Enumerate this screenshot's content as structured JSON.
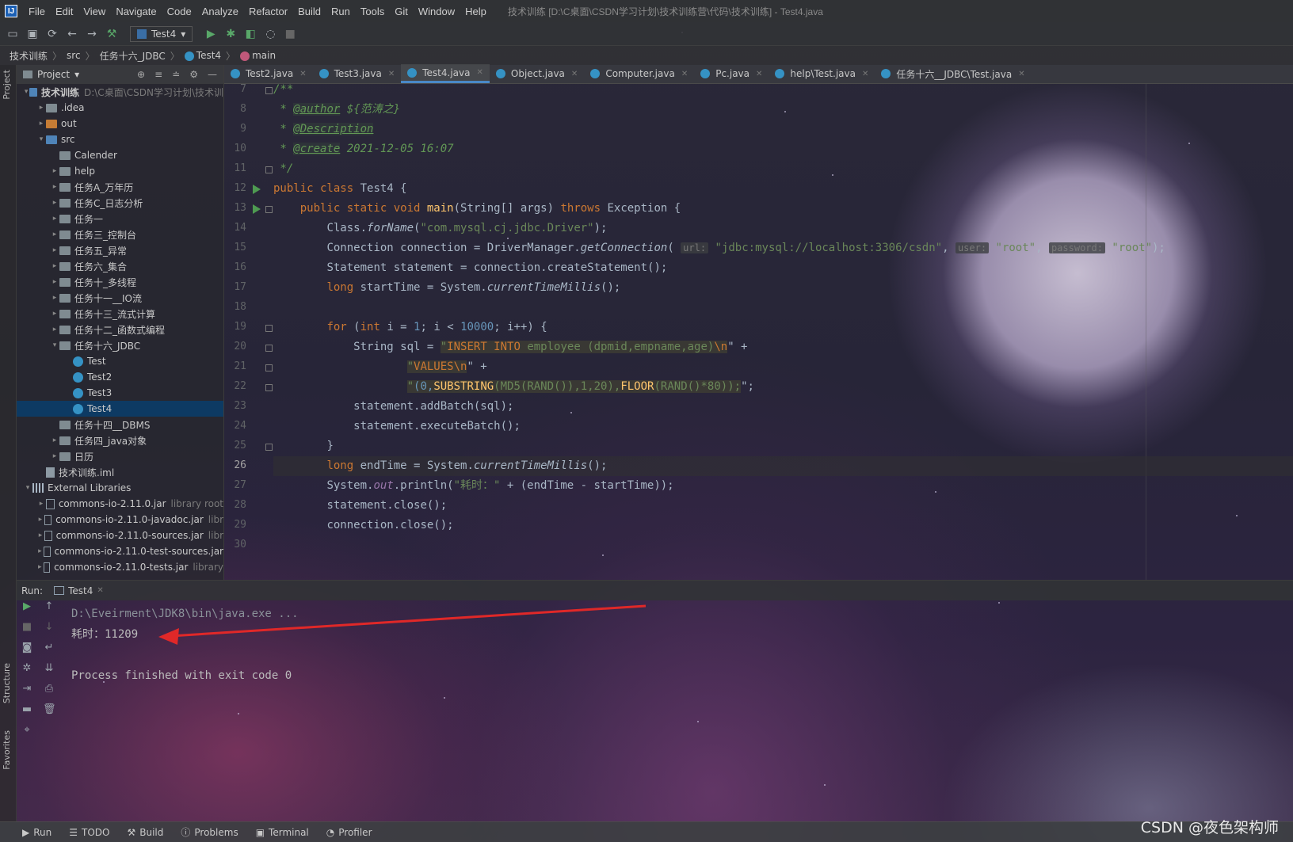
{
  "menu": {
    "logo": "IJ",
    "items": [
      "File",
      "Edit",
      "View",
      "Navigate",
      "Code",
      "Analyze",
      "Refactor",
      "Build",
      "Run",
      "Tools",
      "Git",
      "Window",
      "Help"
    ],
    "window_title": "技术训练 [D:\\C桌面\\CSDN学习计划\\技术训练营\\代码\\技术训练] - Test4.java"
  },
  "toolbar": {
    "run_config": "Test4"
  },
  "breadcrumb": [
    "技术训练",
    "src",
    "任务十六_JDBC",
    "Test4",
    "main"
  ],
  "sidebar_tabs": {
    "project": "Project",
    "structure": "Structure",
    "favorites": "Favorites"
  },
  "project_panel": {
    "title": "Project",
    "tree": [
      {
        "label": "技术训练",
        "hint": "D:\\C桌面\\CSDN学习计划\\技术训",
        "depth": 0,
        "arrow": "▾",
        "icon": "folder-blue",
        "bold": true
      },
      {
        "label": ".idea",
        "hint": "",
        "depth": 1,
        "arrow": "▸",
        "icon": "folder"
      },
      {
        "label": "out",
        "hint": "",
        "depth": 1,
        "arrow": "▸",
        "icon": "folder-orange"
      },
      {
        "label": "src",
        "hint": "",
        "depth": 1,
        "arrow": "▾",
        "icon": "folder-blue"
      },
      {
        "label": "Calender",
        "hint": "",
        "depth": 2,
        "arrow": "",
        "icon": "folder"
      },
      {
        "label": "help",
        "hint": "",
        "depth": 2,
        "arrow": "▸",
        "icon": "folder"
      },
      {
        "label": "任务A_万年历",
        "hint": "",
        "depth": 2,
        "arrow": "▸",
        "icon": "folder"
      },
      {
        "label": "任务C_日志分析",
        "hint": "",
        "depth": 2,
        "arrow": "▸",
        "icon": "folder"
      },
      {
        "label": "任务一",
        "hint": "",
        "depth": 2,
        "arrow": "▸",
        "icon": "folder"
      },
      {
        "label": "任务三_控制台",
        "hint": "",
        "depth": 2,
        "arrow": "▸",
        "icon": "folder"
      },
      {
        "label": "任务五_异常",
        "hint": "",
        "depth": 2,
        "arrow": "▸",
        "icon": "folder"
      },
      {
        "label": "任务六_集合",
        "hint": "",
        "depth": 2,
        "arrow": "▸",
        "icon": "folder"
      },
      {
        "label": "任务十_多线程",
        "hint": "",
        "depth": 2,
        "arrow": "▸",
        "icon": "folder"
      },
      {
        "label": "任务十一__IO流",
        "hint": "",
        "depth": 2,
        "arrow": "▸",
        "icon": "folder"
      },
      {
        "label": "任务十三_流式计算",
        "hint": "",
        "depth": 2,
        "arrow": "▸",
        "icon": "folder"
      },
      {
        "label": "任务十二_函数式编程",
        "hint": "",
        "depth": 2,
        "arrow": "▸",
        "icon": "folder"
      },
      {
        "label": "任务十六_JDBC",
        "hint": "",
        "depth": 2,
        "arrow": "▾",
        "icon": "folder"
      },
      {
        "label": "Test",
        "hint": "",
        "depth": 3,
        "arrow": "",
        "icon": "class"
      },
      {
        "label": "Test2",
        "hint": "",
        "depth": 3,
        "arrow": "",
        "icon": "class"
      },
      {
        "label": "Test3",
        "hint": "",
        "depth": 3,
        "arrow": "",
        "icon": "class"
      },
      {
        "label": "Test4",
        "hint": "",
        "depth": 3,
        "arrow": "",
        "icon": "class",
        "selected": true
      },
      {
        "label": "任务十四__DBMS",
        "hint": "",
        "depth": 2,
        "arrow": "",
        "icon": "folder"
      },
      {
        "label": "任务四_java对象",
        "hint": "",
        "depth": 2,
        "arrow": "▸",
        "icon": "folder"
      },
      {
        "label": "日历",
        "hint": "",
        "depth": 2,
        "arrow": "▸",
        "icon": "folder"
      },
      {
        "label": "技术训练.iml",
        "hint": "",
        "depth": 1,
        "arrow": "",
        "icon": "iml"
      },
      {
        "label": "External Libraries",
        "hint": "",
        "depth": 0,
        "arrow": "▾",
        "icon": "lib"
      },
      {
        "label": "commons-io-2.11.0.jar",
        "hint": "library root",
        "depth": 1,
        "arrow": "▸",
        "icon": "jar"
      },
      {
        "label": "commons-io-2.11.0-javadoc.jar",
        "hint": "libr",
        "depth": 1,
        "arrow": "▸",
        "icon": "jar"
      },
      {
        "label": "commons-io-2.11.0-sources.jar",
        "hint": "libr",
        "depth": 1,
        "arrow": "▸",
        "icon": "jar"
      },
      {
        "label": "commons-io-2.11.0-test-sources.jar",
        "hint": "",
        "depth": 1,
        "arrow": "▸",
        "icon": "jar"
      },
      {
        "label": "commons-io-2.11.0-tests.jar",
        "hint": "library",
        "depth": 1,
        "arrow": "▸",
        "icon": "jar"
      }
    ]
  },
  "editor_tabs": [
    {
      "label": "Test2.java",
      "active": false
    },
    {
      "label": "Test3.java",
      "active": false
    },
    {
      "label": "Test4.java",
      "active": true
    },
    {
      "label": "Object.java",
      "active": false
    },
    {
      "label": "Computer.java",
      "active": false
    },
    {
      "label": "Pc.java",
      "active": false
    },
    {
      "label": "help\\Test.java",
      "active": false
    },
    {
      "label": "任务十六__JDBC\\Test.java",
      "active": false
    }
  ],
  "line_numbers": [
    "7",
    "8",
    "9",
    "10",
    "11",
    "12",
    "13",
    "14",
    "15",
    "16",
    "17",
    "18",
    "19",
    "20",
    "21",
    "22",
    "23",
    "24",
    "25",
    "26",
    "27",
    "28",
    "29",
    "30"
  ],
  "current_line": "26",
  "code": {
    "l7": "/**",
    "l8_star": " * ",
    "l8_tag": "@author",
    "l8_val": " ${范涛之}",
    "l9_star": " * ",
    "l9_tag": "@Description",
    "l10_star": " * ",
    "l10_tag": "@create",
    "l10_val": " 2021-12-05 16:07",
    "l11": " */",
    "l12_kw": "public class",
    "l12_rest": " Test4 {",
    "l13_kw": "public static void",
    "l13_fn": "main",
    "l13_args": "(String[] args) ",
    "l13_throws": "throws",
    "l13_rest": " Exception {",
    "l14_a": "Class.",
    "l14_m": "forName",
    "l14_s": "\"com.mysql.cj.jdbc.Driver\"",
    "l14_e": ");",
    "l15_a": "Connection connection = DriverManager.",
    "l15_m": "getConnection",
    "l15_h1": "url:",
    "l15_s1": "\"jdbc:mysql://localhost:3306/csdn\"",
    "l15_h2": "user:",
    "l15_s2": "\"root\"",
    "l15_h3": "password:",
    "l15_s3": "\"root\"",
    "l15_e": ");",
    "l16": "Statement statement = connection.createStatement();",
    "l17_kw": "long",
    "l17_a": " startTime = System.",
    "l17_m": "currentTimeMillis",
    "l17_e": "();",
    "l19_kw": "for",
    "l19_a": " (",
    "l19_int": "int",
    "l19_b": " i = ",
    "l19_n1": "1",
    "l19_c": "; i < ",
    "l19_n2": "10000",
    "l19_d": "; i++) {",
    "l20_a": "String sql = ",
    "l20_q": "\"",
    "l20_k1": "INSERT INTO",
    "l20_b": " employee (dpmid,empname,age)",
    "l20_esc": "\\n",
    "l20_e": "\" +",
    "l21_q": "\"",
    "l21_k": "VALUES",
    "l21_esc": "\\n",
    "l21_e": "\" +",
    "l22_q": "\"",
    "l22_a": "(0,",
    "l22_f1": "SUBSTRING",
    "l22_b": "(MD5(RAND()),1,20),",
    "l22_f2": "FLOOR",
    "l22_c": "(RAND()*80));",
    "l22_e": "\";",
    "l23": "statement.addBatch(sql);",
    "l24": "statement.executeBatch();",
    "l25": "}",
    "l26_kw": "long",
    "l26_a": " endTime = System.",
    "l26_m": "currentTimeMillis",
    "l26_e": "();",
    "l27_a": "System.",
    "l27_out": "out",
    "l27_b": ".println(",
    "l27_s": "\"耗时：\"",
    "l27_c": " + (endTime - startTime));",
    "l28": "statement.close();",
    "l29": "connection.close();"
  },
  "run_panel": {
    "label": "Run:",
    "tab": "Test4",
    "console": [
      "D:\\Eveirment\\JDK8\\bin\\java.exe ...",
      "耗时：11209",
      "",
      "Process finished with exit code 0"
    ]
  },
  "statusbar": [
    "Run",
    "TODO",
    "Build",
    "Problems",
    "Terminal",
    "Profiler"
  ],
  "watermark": "CSDN @夜色架构师",
  "colors": {
    "keyword": "#cc7832",
    "string": "#6a8759",
    "number": "#6897bb",
    "selection": "#0d3a63",
    "arrow": "#e02828"
  }
}
